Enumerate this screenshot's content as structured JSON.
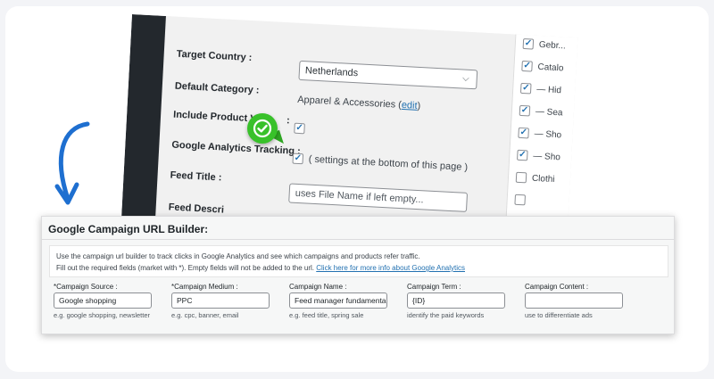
{
  "settings_form": {
    "target_country_label": "Target Country :",
    "target_country_value": "Netherlands",
    "default_category_label": "Default Category :",
    "default_category_value": "Apparel & Accessories (",
    "default_category_edit": "edit",
    "default_category_close": ")",
    "include_variations_label": "Include Product Va",
    "include_variations_label_tail": ":",
    "analytics_label": "Google Analytics Tracking :",
    "analytics_note": "( settings at the bottom of this page )",
    "feed_title_label": "Feed Title :",
    "feed_title_placeholder": "uses File Name if left empty...",
    "feed_description_label": "Feed Descri"
  },
  "category_tree": [
    {
      "label": "Gebr...",
      "checked": true
    },
    {
      "label": "Catalo",
      "checked": true
    },
    {
      "label": "— Hid",
      "checked": true
    },
    {
      "label": "— Sea",
      "checked": true
    },
    {
      "label": "— Sho",
      "checked": true
    },
    {
      "label": "— Sho",
      "checked": true
    },
    {
      "label": "Clothi",
      "checked": false
    },
    {
      "label": "",
      "checked": false
    }
  ],
  "checkmark": "✓",
  "builder": {
    "title": "Google Campaign URL Builder:",
    "info_line1": "Use the campaign url builder to track clicks in Google Analytics and see which campaigns and products refer traffic.",
    "info_line2": "Fill out the required fields (market with *). Empty fields will not be added to the url. ",
    "info_link": "Click here for more info about Google Analytics",
    "fields": [
      {
        "label": "*Campaign Source :",
        "value": "Google shopping",
        "hint": "e.g. google shopping, newsletter"
      },
      {
        "label": "*Campaign Medium :",
        "value": "PPC",
        "hint": "e.g. cpc, banner, email"
      },
      {
        "label": "Campaign Name :",
        "value": "Feed manager fundamentals",
        "hint": "e.g. feed title, spring sale"
      },
      {
        "label": "Campaign Term :",
        "value": "{ID}",
        "hint": "identify the paid keywords"
      },
      {
        "label": "Campaign Content :",
        "value": "",
        "hint": "use to differentiate ads"
      }
    ]
  },
  "colors": {
    "accent_blue": "#1e6fd0",
    "badge_green": "#38c12a",
    "link": "#2271b1"
  }
}
